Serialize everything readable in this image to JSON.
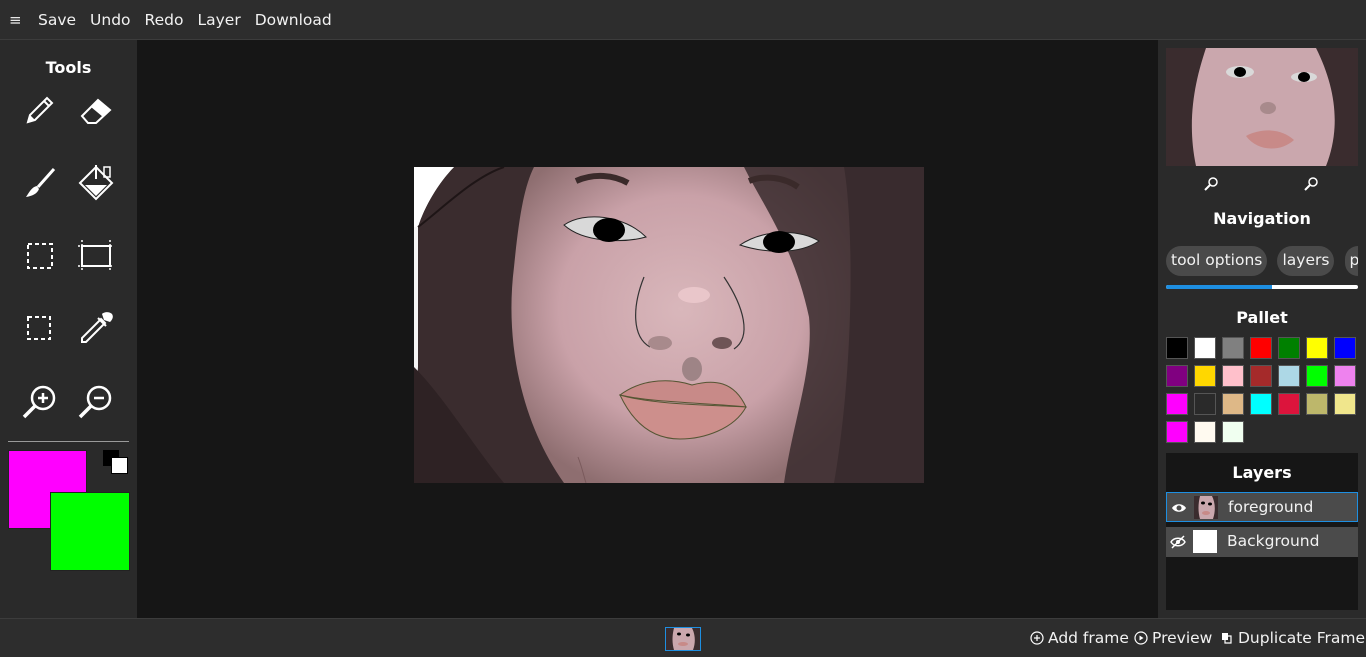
{
  "menu": {
    "icon": "hamburger-menu-icon",
    "items": [
      "Save",
      "Undo",
      "Redo",
      "Layer",
      "Download"
    ]
  },
  "tools": {
    "title": "Tools",
    "icons": [
      "pencil-icon",
      "eraser-icon",
      "brush-icon",
      "fill-bucket-icon",
      "rect-select-icon",
      "crop-icon",
      "lasso-select-icon",
      "eyedropper-icon",
      "zoom-in-icon",
      "zoom-out-icon"
    ],
    "primary_color": "#ff00ff",
    "secondary_color": "#00ff00"
  },
  "right": {
    "navigation_title": "Navigation",
    "tabs": [
      "tool options",
      "layers",
      "pr"
    ],
    "tab_progress": 0.55,
    "pallet_title": "Pallet",
    "pallet_colors": [
      "#000000",
      "#ffffff",
      "#808080",
      "#ff0000",
      "#008000",
      "#ffff00",
      "#0000ff",
      "#800080",
      "#ffd700",
      "#ffc0cb",
      "#a52a2a",
      "#add8e6",
      "#00ff00",
      "#ee82ee",
      "#ff00ff",
      "#2a2a2a",
      "#deb887",
      "#00ffff",
      "#dc143c",
      "#bdb76b",
      "#f0e68c",
      "#ff00ff",
      "#fffaf0",
      "#f0fff0"
    ],
    "layers_title": "Layers",
    "layers": [
      {
        "name": "foreground",
        "visible": true
      },
      {
        "name": "Background",
        "visible": false
      }
    ]
  },
  "bottom": {
    "add_frame": "Add frame",
    "preview": "Preview",
    "duplicate_frame": "Duplicate Frame"
  },
  "colors": {
    "accent": "#1e8fe1",
    "panel": "#2a2a2a",
    "workspace": "#161616"
  }
}
